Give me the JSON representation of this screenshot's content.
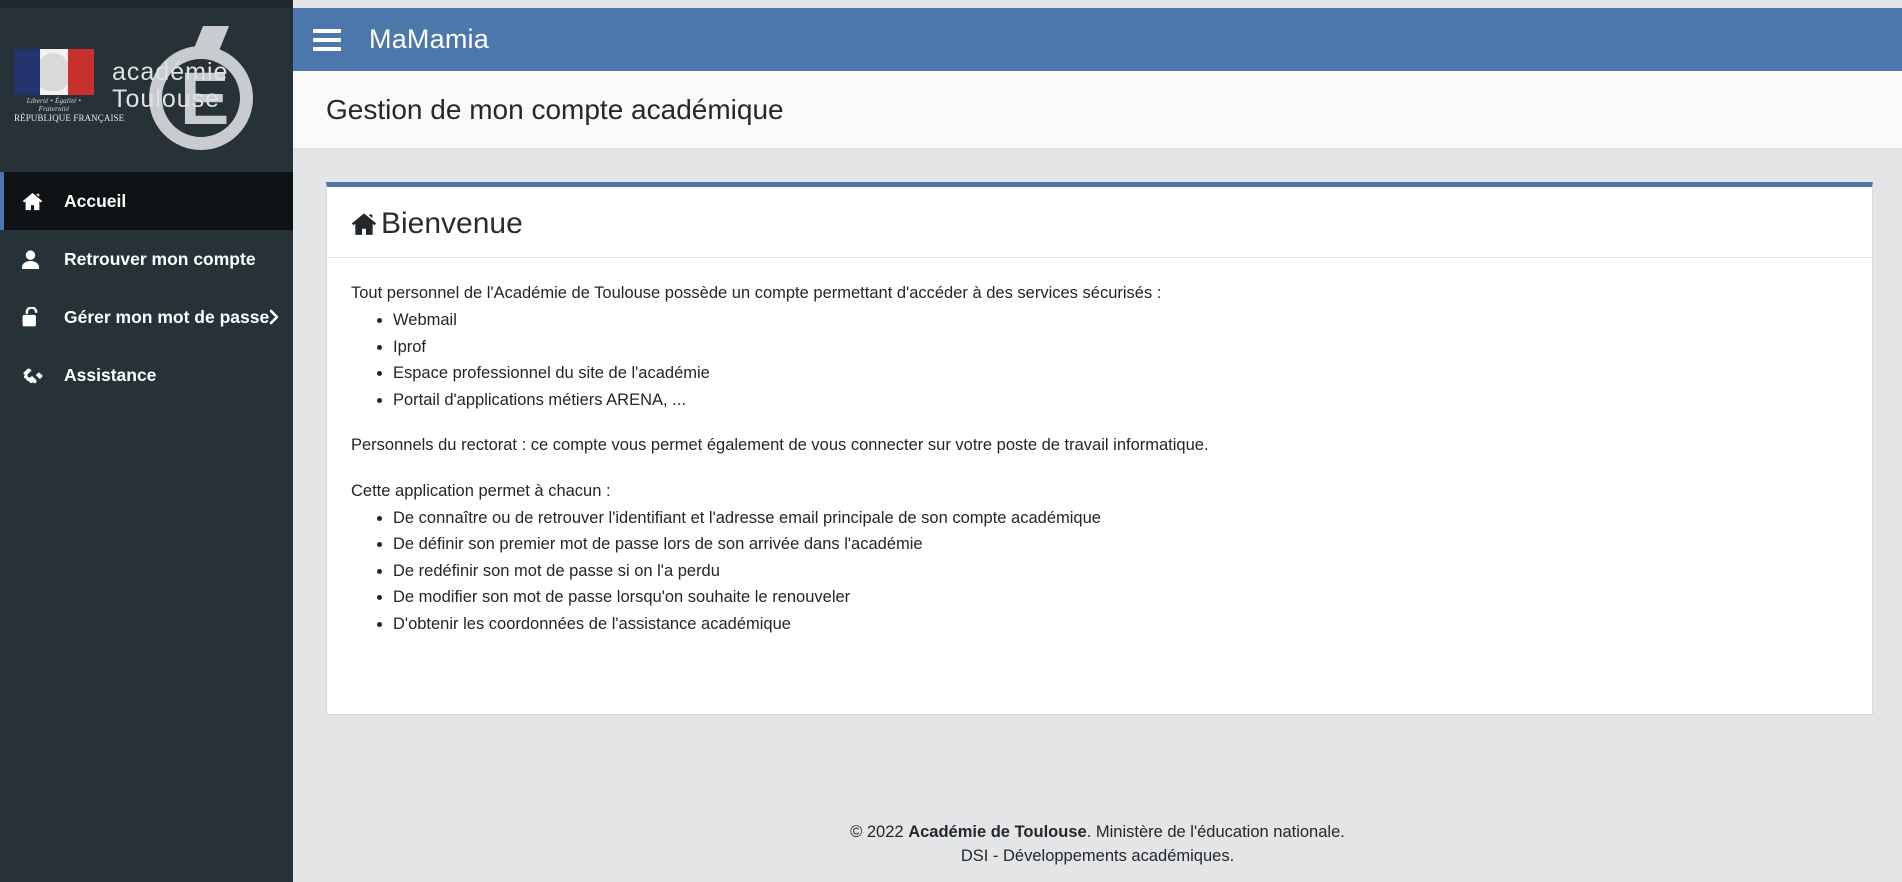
{
  "brand": {
    "republic_motto": "Liberté • Égalité • Fraternité",
    "republic_name": "RÉPUBLIQUE FRANÇAISE",
    "academy_line1": "académie",
    "academy_line2": "Toulouse",
    "watermark_letter": "E"
  },
  "sidebar": {
    "items": [
      {
        "label": "Accueil",
        "icon": "home-icon",
        "active": true,
        "has_chevron": false
      },
      {
        "label": "Retrouver mon compte",
        "icon": "user-icon",
        "active": false,
        "has_chevron": false
      },
      {
        "label": "Gérer mon mot de passe",
        "icon": "unlock-icon",
        "active": false,
        "has_chevron": true
      },
      {
        "label": "Assistance",
        "icon": "handshake-icon",
        "active": false,
        "has_chevron": false
      }
    ]
  },
  "topbar": {
    "menu_icon": "hamburger-icon",
    "app_title": "MaMamia",
    "background_color": "#4b77ad"
  },
  "page": {
    "title": "Gestion de mon compte académique"
  },
  "card": {
    "accent_color": "#4b77ad",
    "heading_icon": "home-icon",
    "heading": "Bienvenue",
    "intro": "Tout personnel de l'Académie de Toulouse possède un compte permettant d'accéder à des services sécurisés :",
    "services": [
      "Webmail",
      "Iprof",
      "Espace professionnel du site de l'académie",
      "Portail d'applications métiers ARENA, ..."
    ],
    "rectorat_note": "Personnels du rectorat : ce compte vous permet également de vous connecter sur votre poste de travail informatique.",
    "features_intro": "Cette application permet à chacun :",
    "features": [
      "De connaître ou de retrouver l'identifiant et l'adresse email principale de son compte académique",
      "De définir son premier mot de passe lors de son arrivée dans l'académie",
      "De redéfinir son mot de passe si on l'a perdu",
      "De modifier son mot de passe lorsqu'on souhaite le renouveler",
      "D'obtenir les coordonnées de l'assistance académique"
    ]
  },
  "footer": {
    "line1_prefix": "© 2022 ",
    "line1_bold": "Académie de Toulouse",
    "line1_suffix": ". Ministère de l'éducation nationale.",
    "line2": "DSI - Développements académiques."
  }
}
